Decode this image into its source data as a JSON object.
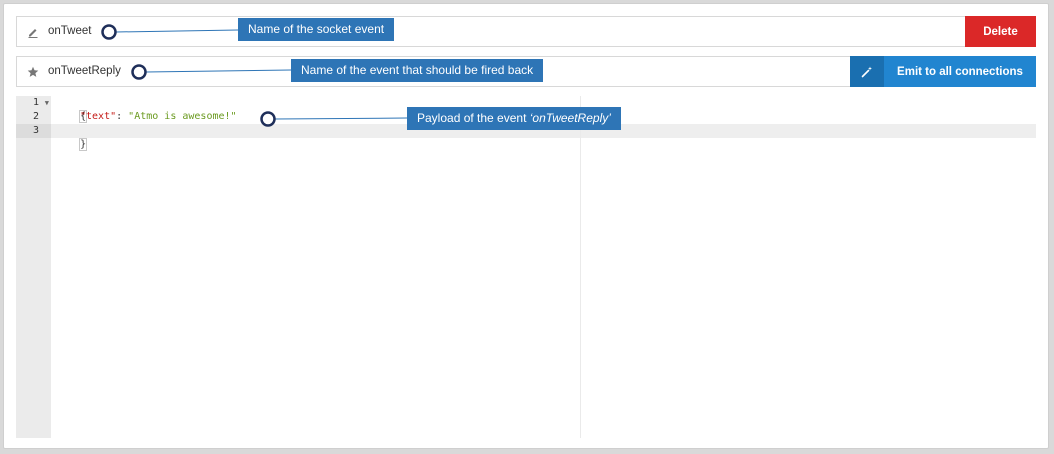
{
  "events": {
    "listen": {
      "name": "onTweet",
      "icon": "pencil-icon"
    },
    "reply": {
      "name": "onTweetReply",
      "icon": "star-icon"
    }
  },
  "buttons": {
    "delete_label": "Delete",
    "emit_label": "Emit to all connections",
    "emit_icon": "magic-wand-icon"
  },
  "editor": {
    "line_numbers": [
      "1",
      "2",
      "3"
    ],
    "line1": "{",
    "line2_key": "\"text\"",
    "line2_colon": ": ",
    "line2_value": "\"Atmo is awesome!\"",
    "line3": "}"
  },
  "annotations": {
    "socket_event": "Name of the socket event",
    "fired_back": "Name of the event that should be fired back",
    "payload_prefix": "Payload of the event ",
    "payload_event": "‘onTweetReply’"
  },
  "colors": {
    "delete": "#db2828",
    "emit": "#2185d0",
    "annotation": "#2e75b6",
    "annotation_ring": "#1f2f5a"
  }
}
